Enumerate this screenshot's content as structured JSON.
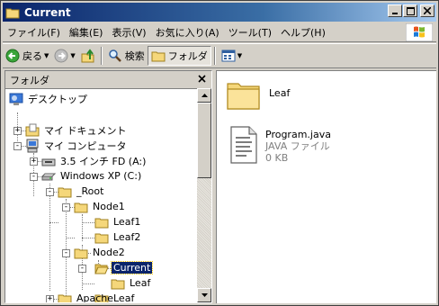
{
  "window": {
    "title": "Current"
  },
  "menu": {
    "items": [
      "ファイル(F)",
      "編集(E)",
      "表示(V)",
      "お気に入り(A)",
      "ツール(T)",
      "ヘルプ(H)"
    ]
  },
  "toolbar": {
    "back_label": "戻る",
    "search_label": "検索",
    "folders_label": "フォルダ"
  },
  "folder_pane": {
    "title": "フォルダ",
    "tree": [
      {
        "label": "デスクトップ",
        "icon": "desktop-icon",
        "expander": ""
      },
      {
        "label": "マイ ドキュメント",
        "icon": "my-documents-icon",
        "expander": "+"
      },
      {
        "label": "マイ コンピュータ",
        "icon": "my-computer-icon",
        "expander": "-"
      },
      {
        "label": "3.5 インチ FD (A:)",
        "icon": "floppy-drive-icon",
        "expander": "+"
      },
      {
        "label": "Windows XP (C:)",
        "icon": "hard-drive-icon",
        "expander": "-"
      },
      {
        "label": "_Root",
        "icon": "folder-icon",
        "expander": "-"
      },
      {
        "label": "Node1",
        "icon": "folder-icon",
        "expander": "-"
      },
      {
        "label": "Leaf1",
        "icon": "folder-icon",
        "expander": ""
      },
      {
        "label": "Leaf2",
        "icon": "folder-icon",
        "expander": ""
      },
      {
        "label": "Node2",
        "icon": "folder-icon",
        "expander": "-"
      },
      {
        "label": "Current",
        "icon": "open-folder-icon",
        "expander": "-",
        "selected": true
      },
      {
        "label": "Leaf",
        "icon": "folder-icon",
        "expander": ""
      },
      {
        "label": "Leaf",
        "icon": "folder-icon",
        "expander": ""
      },
      {
        "label": "Apache",
        "icon": "folder-icon",
        "expander": "+"
      }
    ]
  },
  "files": [
    {
      "name": "Leaf",
      "type": "",
      "size": "",
      "icon": "folder-icon"
    },
    {
      "name": "Program.java",
      "type": "JAVA ファイル",
      "size": "0 KB",
      "icon": "text-file-icon"
    }
  ]
}
